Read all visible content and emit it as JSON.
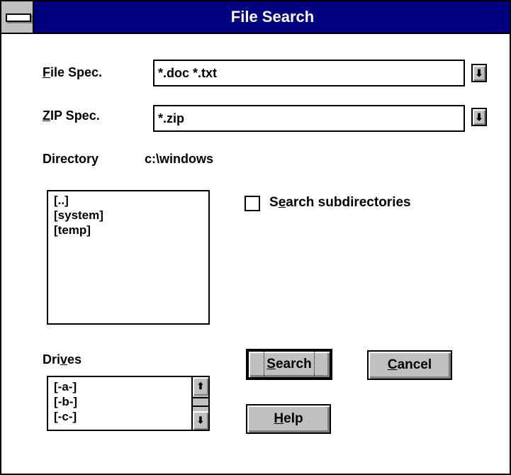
{
  "window": {
    "title": "File Search"
  },
  "file_spec": {
    "label_hotkey": "F",
    "label_rest": "ile Spec.",
    "value": "*.doc *.txt",
    "dropdown_icon": "arrow-down-icon"
  },
  "zip_spec": {
    "label_hotkey": "Z",
    "label_rest": "IP Spec.",
    "value": "*.zip",
    "dropdown_icon": "arrow-down-icon"
  },
  "directory": {
    "label": "Directory",
    "value": "c:\\windows"
  },
  "dir_list": {
    "items": [
      "[..]",
      "[system]",
      "[temp]"
    ]
  },
  "search_subdirs": {
    "label_pre": "S",
    "label_hotkey": "e",
    "label_rest": "arch subdirectories",
    "checked": false
  },
  "drives": {
    "label_pre": "Dri",
    "label_hotkey": "v",
    "label_rest": "es",
    "items": [
      "[-a-]",
      "[-b-]",
      "[-c-]"
    ]
  },
  "buttons": {
    "search": {
      "hotkey": "S",
      "rest": "earch"
    },
    "cancel": {
      "hotkey": "C",
      "rest": "ancel"
    },
    "help": {
      "hotkey": "H",
      "rest": "elp"
    }
  },
  "colors": {
    "titlebar": "#000080",
    "face": "#c0c0c0"
  }
}
